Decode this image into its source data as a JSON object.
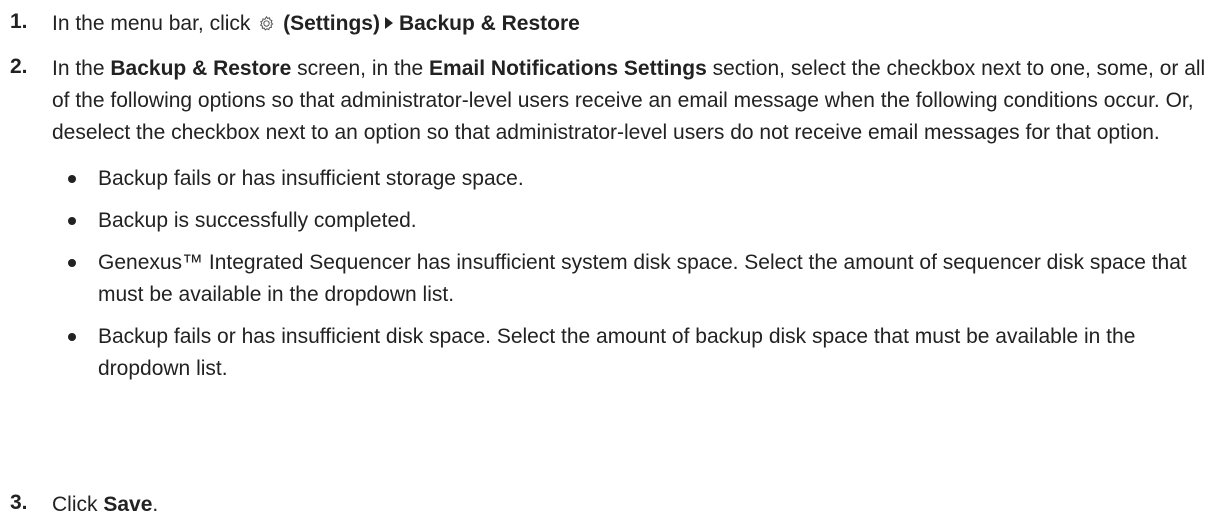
{
  "steps": [
    {
      "number": "1.",
      "text_before": "In the menu bar, click",
      "icon": "gear-icon",
      "settings_label": "(Settings)",
      "menu_item": "Backup & Restore"
    },
    {
      "number": "2.",
      "text_1": "In the",
      "screen_name": "Backup & Restore",
      "text_2": "screen, in the",
      "section_name": "Email Notifications Settings",
      "text_3": "section, select the checkbox next to one, some, or all of the following options so that administrator-level users receive an email message when the following conditions occur. Or, deselect the checkbox next to an option so that administrator-level users do not receive email messages for that option.",
      "options": [
        "Backup fails or has insufficient storage space.",
        "Backup is successfully completed.",
        "Genexus™ Integrated Sequencer has insufficient system disk space. Select the amount of sequencer disk space that must be available in the dropdown list.",
        "Backup fails or has insufficient disk space. Select the amount of backup disk space that must be available in the dropdown list."
      ]
    },
    {
      "number": "3.",
      "text_before": "Click",
      "button_name": "Save",
      "text_after": "."
    }
  ]
}
